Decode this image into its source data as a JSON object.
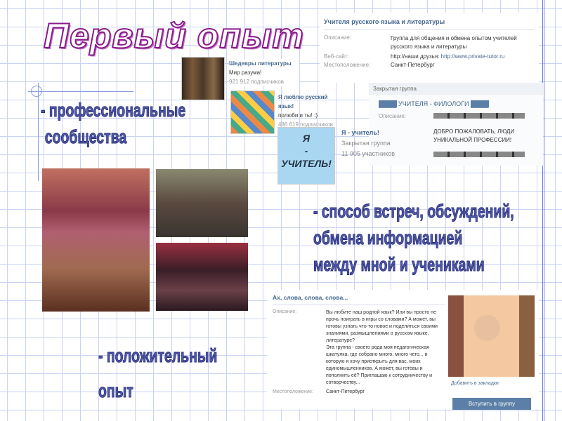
{
  "slide": {
    "title": "Первый опыт",
    "bullet1": [
      "- профессиональные",
      "сообщества"
    ],
    "bullet2": [
      "- способ встреч, обсуждений,",
      "обмена информацией",
      "между мной и учениками"
    ],
    "bullet3": [
      "- положительный",
      "опыт"
    ]
  },
  "group_teachers": {
    "title": "Учителя русского языка и литературы",
    "desc_label": "Описание:",
    "desc": "Группа для общения и обмена опытом учителей русского языка и литературы",
    "site_label": "Веб-сайт:",
    "site_prefix": "http://наши друзья: ",
    "site_link": "http://www.private-tutor.ru",
    "loc_label": "Местоположение:",
    "loc": "Санкт-Петербург"
  },
  "list": [
    {
      "name": "Шедевры литературы",
      "status": "Мир разума!",
      "count": "921 912 подписчиков"
    },
    {
      "name": "Я люблю русский язык!",
      "status": "полюби и ты! :)",
      "count": "486 619 подписчиков"
    }
  ],
  "ya_uchitel": {
    "name": "Я - учитель!",
    "type": "Закрытая группа",
    "count": "11 905 участников",
    "poster": [
      "Я",
      "-",
      "УЧИТЕЛЬ!"
    ]
  },
  "filologi": {
    "type": "Закрытая группа",
    "title": "УЧИТЕЛЯ - ФИЛОЛОГИ",
    "desc_label": "Описание:",
    "welcome": "ДОБРО ПОЖАЛОВАТЬ, ЛЮДИ УНИКАЛЬНОЙ ПРОФЕССИИ!"
  },
  "slova": {
    "title": "Ах, слова, слова, слова...",
    "desc_label": "Описание:",
    "desc": "Вы любите наш родной язык? Или вы просто не прочь поиграть в игры со словами? А может, вы готовы узнать что-то новое и поделиться своими знаниями, размышлениями о русском языке, литературе?",
    "desc2": "Эта группа - своего рода моя педагогическая шкатулка, где собрано много, много чего... и которую я хочу приоткрыть для вас, моих единомышленников. А может, вы готовы и пополнить её? Приглашаю к сотрудничеству и сотворчеству...",
    "loc_label": "Местоположение:",
    "loc": "Санкт-Петербург",
    "bookmark": "Добавить в закладки",
    "join": "Вступить в группу"
  }
}
